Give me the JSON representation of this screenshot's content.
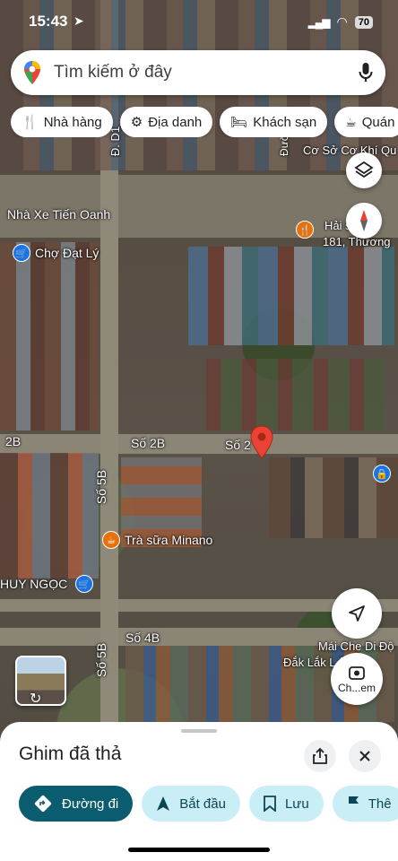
{
  "status_bar": {
    "time": "15:43",
    "battery": "70"
  },
  "search": {
    "placeholder": "Tìm kiếm ở đây"
  },
  "chips": [
    "Nhà hàng",
    "Địa danh",
    "Khách sạn",
    "Quán"
  ],
  "map_labels": {
    "road_d1": "Đ. D1",
    "road_duong_so": "Đường số",
    "co_so": "Cơ Sở Cơ Khí Qu",
    "nha_xe": "Nhà Xe Tiến Oanh",
    "hai_san": "Hải s   ơi S",
    "address_181": "181, Thương",
    "cho_dat_ly": "Chợ Đạt Lý",
    "road_2b_left": "2B",
    "road_so_2b": "Số 2B",
    "road_so_2": "Số 2",
    "road_so_5b_top": "Số 5B",
    "road_so_5b_bottom": "Số 5B",
    "tra_sua": "Trà sữa Minano",
    "huy_ngoc": "HUY NGỌC",
    "road_so_4b": "Số 4B",
    "mai_che": "Mái Che Di Độ",
    "dak_lak": "Đắk Lắk L        ỏ Ba",
    "overlay_road": "Đường số"
  },
  "lens_button": {
    "label": "Ch...em"
  },
  "sheet": {
    "title": "Ghim đã thả",
    "actions": [
      {
        "label": "Đường đi",
        "icon": "directions-icon"
      },
      {
        "label": "Bắt đầu",
        "icon": "navigation-arrow-icon"
      },
      {
        "label": "Lưu",
        "icon": "bookmark-icon"
      },
      {
        "label": "Thê",
        "icon": "flag-icon"
      }
    ]
  },
  "colors": {
    "accent_primary": "#0b5c6e",
    "accent_secondary": "#c9eef6",
    "pin_red": "#ea4335",
    "poi_blue": "#1a73e8",
    "poi_orange": "#e8710a"
  }
}
